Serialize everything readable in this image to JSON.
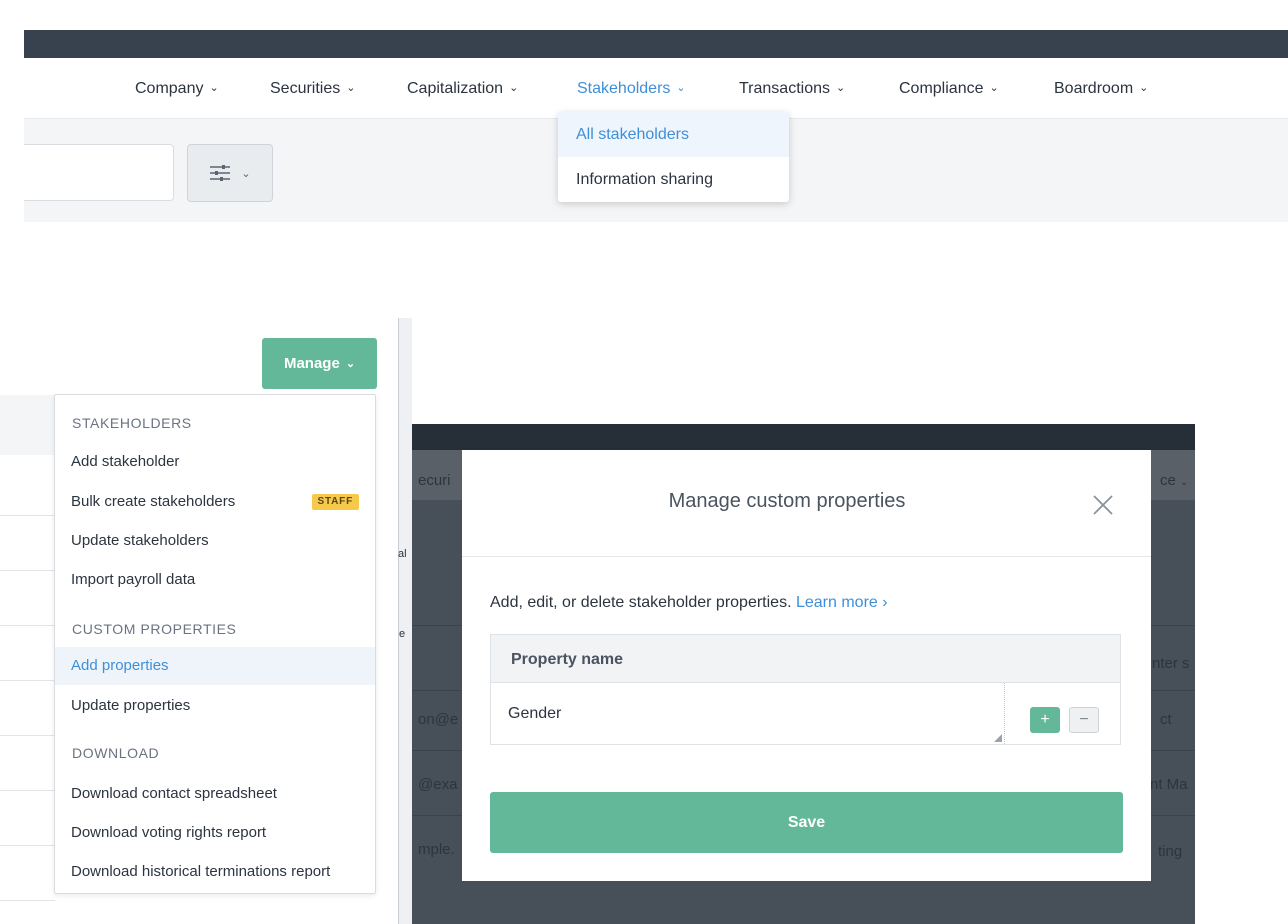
{
  "nav": {
    "items": [
      {
        "label": "Company"
      },
      {
        "label": "Securities"
      },
      {
        "label": "Capitalization"
      },
      {
        "label": "Stakeholders"
      },
      {
        "label": "Transactions"
      },
      {
        "label": "Compliance"
      },
      {
        "label": "Boardroom"
      }
    ],
    "active": "Stakeholders"
  },
  "stakeholders_menu": {
    "items": [
      "All stakeholders",
      "Information sharing"
    ]
  },
  "manage": {
    "button_label": "Manage",
    "sections": [
      {
        "title": "STAKEHOLDERS",
        "items": [
          "Add stakeholder",
          "Bulk create stakeholders",
          "Update stakeholders",
          "Import payroll data"
        ]
      },
      {
        "title": "CUSTOM PROPERTIES",
        "items": [
          "Add properties",
          "Update properties"
        ]
      },
      {
        "title": "DOWNLOAD",
        "items": [
          "Download contact spreadsheet",
          "Download voting rights report",
          "Download historical terminations report"
        ]
      }
    ],
    "staff_badge": "STAFF",
    "left_fragments": [
      "al",
      "e"
    ]
  },
  "modal": {
    "title": "Manage custom properties",
    "description": "Add, edit, or delete stakeholder properties.",
    "learn_more": "Learn more ›",
    "table_header": "Property name",
    "properties": [
      "Gender"
    ],
    "save_label": "Save"
  },
  "background": {
    "left_texts": [
      "ecuri",
      "on@e",
      "@exa",
      "mple."
    ],
    "right_texts": [
      "ce",
      "nter s",
      "ct",
      "nt Ma",
      "ting"
    ]
  },
  "colors": {
    "accent_green": "#63b89a",
    "link_blue": "#3f8fd8",
    "nav_dark": "#37424e",
    "staff_yellow": "#f6c94a"
  }
}
